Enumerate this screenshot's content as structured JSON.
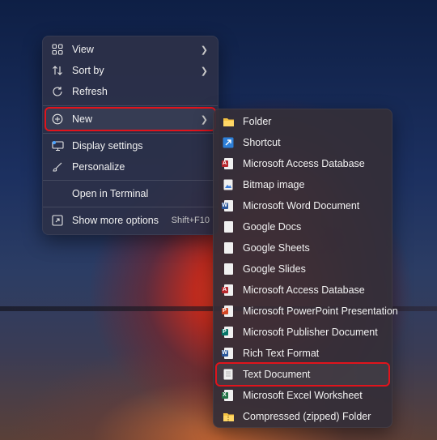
{
  "context_menu": {
    "items": [
      {
        "label": "View",
        "icon": "grid-icon"
      },
      {
        "label": "Sort by",
        "icon": "sort-icon"
      },
      {
        "label": "Refresh",
        "icon": "refresh-icon"
      },
      {
        "label": "New",
        "icon": "plus-circle-icon"
      },
      {
        "label": "Display settings",
        "icon": "display-icon"
      },
      {
        "label": "Personalize",
        "icon": "brush-icon"
      },
      {
        "label": "Open in Terminal",
        "icon": ""
      },
      {
        "label": "Show more options",
        "icon": "more-options-icon",
        "shortcut": "Shift+F10"
      }
    ]
  },
  "new_submenu": {
    "items": [
      {
        "label": "Folder",
        "icon": "folder-icon"
      },
      {
        "label": "Shortcut",
        "icon": "shortcut-icon"
      },
      {
        "label": "Microsoft Access Database",
        "icon": "access-icon"
      },
      {
        "label": "Bitmap image",
        "icon": "bitmap-icon"
      },
      {
        "label": "Microsoft Word Document",
        "icon": "word-icon"
      },
      {
        "label": "Google Docs",
        "icon": "file-icon"
      },
      {
        "label": "Google Sheets",
        "icon": "file-icon"
      },
      {
        "label": "Google Slides",
        "icon": "file-icon"
      },
      {
        "label": "Microsoft Access Database",
        "icon": "access-icon"
      },
      {
        "label": "Microsoft PowerPoint Presentation",
        "icon": "powerpoint-icon"
      },
      {
        "label": "Microsoft Publisher Document",
        "icon": "publisher-icon"
      },
      {
        "label": "Rich Text Format",
        "icon": "word-icon"
      },
      {
        "label": "Text Document",
        "icon": "text-file-icon"
      },
      {
        "label": "Microsoft Excel Worksheet",
        "icon": "excel-icon"
      },
      {
        "label": "Compressed (zipped) Folder",
        "icon": "zip-folder-icon"
      }
    ]
  },
  "highlight_color": "#e0141c"
}
